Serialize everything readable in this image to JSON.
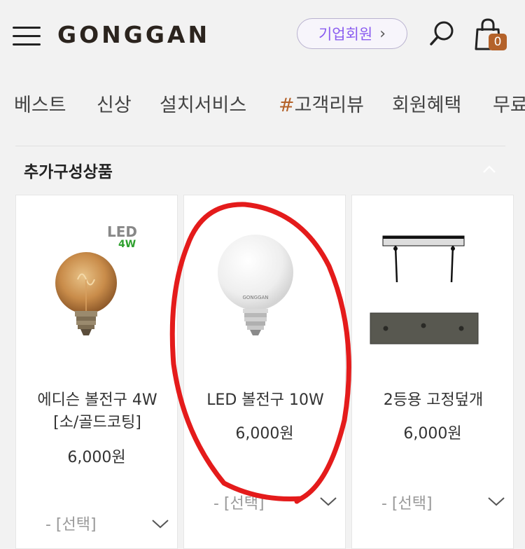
{
  "header": {
    "logo": "GONGGAN",
    "corp_button_label": "기업회원",
    "corp_button_chevron": "›",
    "cart_count": "0",
    "icons": [
      "menu-icon",
      "search-icon",
      "shopping-bag-icon"
    ]
  },
  "nav": {
    "items": [
      {
        "label": "베스트"
      },
      {
        "label": "신상"
      },
      {
        "label": "설치서비스"
      },
      {
        "label_hash": "#",
        "label": "고객리뷰"
      },
      {
        "label": "회원혜택"
      },
      {
        "label": "무료"
      }
    ]
  },
  "section": {
    "title": "추가구성상품"
  },
  "products": [
    {
      "name_line1": "에디슨 볼전구 4W",
      "name_line2": "[소/골드코팅]",
      "price": "6,000원",
      "select_label": "- [선택]",
      "badge_led": "LED",
      "badge_watt": "4W"
    },
    {
      "name_line1": "LED 볼전구 10W",
      "price": "6,000원",
      "select_label": "- [선택]",
      "bulb_text": "GONGGAN"
    },
    {
      "name_line1": "2등용 고정덮개",
      "price": "6,000원",
      "select_label": "- [선택]"
    }
  ],
  "colors": {
    "accent": "#b4622a",
    "corp_purple": "#8a5cf0",
    "annotation_red": "#e41b1b",
    "background": "#f2f2f2"
  }
}
